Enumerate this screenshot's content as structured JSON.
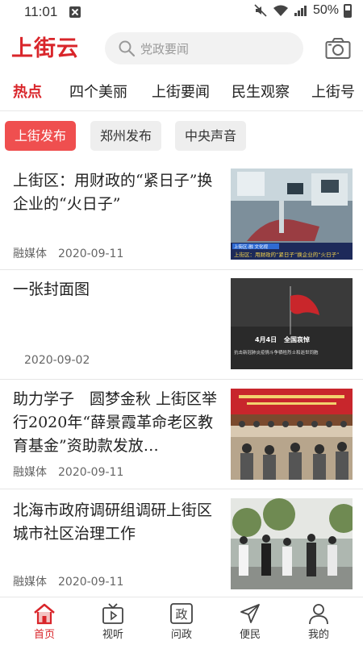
{
  "status_bar": {
    "time": "11:01",
    "battery": "50%"
  },
  "header": {
    "logo": "上街云",
    "search_placeholder": "党政要闻"
  },
  "tabs": [
    "热点",
    "四个美丽",
    "上街要闻",
    "民生观察",
    "上街号"
  ],
  "active_tab": 0,
  "subtabs": [
    "上街发布",
    "郑州发布",
    "中央声音"
  ],
  "active_subtab": 0,
  "news": [
    {
      "title": "上街区：用财政的“紧日子”换企业的“火日子”",
      "source": "融媒体",
      "date": "2020-09-11",
      "thumb_caption": "上街区：用财政的“紧日子”换企业的“火日子”"
    },
    {
      "title": "一张封面图",
      "source": "",
      "date": "2020-09-02",
      "thumb_caption_1": "4月4日",
      "thumb_caption_2": "全国哀悼",
      "thumb_caption_3": "抗击新冠肺炎疫情斗争牺牲烈士和逝世同胞"
    },
    {
      "title": "助力学子　圆梦金秋 上街区举行2020年“薛景霞革命老区教育基金”资助款发放…",
      "source": "融媒体",
      "date": "2020-09-11"
    },
    {
      "title": "北海市政府调研组调研上街区城市社区治理工作",
      "source": "融媒体",
      "date": "2020-09-11"
    }
  ],
  "bottom_nav": [
    {
      "label": "首页",
      "icon": "home-icon"
    },
    {
      "label": "视听",
      "icon": "tv-icon"
    },
    {
      "label": "问政",
      "icon": "ask-icon",
      "glyph": "政"
    },
    {
      "label": "便民",
      "icon": "send-icon"
    },
    {
      "label": "我的",
      "icon": "user-icon"
    }
  ],
  "colors": {
    "accent": "#d9252a",
    "pill_active": "#ef4f4f"
  }
}
